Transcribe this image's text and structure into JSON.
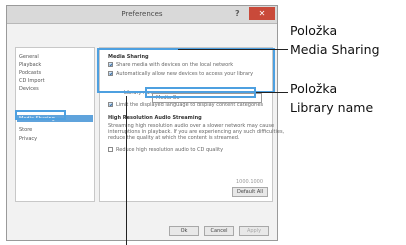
{
  "dialog": {
    "title": "Preferences",
    "help_glyph": "?",
    "close_glyph": "✕",
    "sidebar_items": [
      "General",
      "Playback",
      "Podcasts",
      "CD Import",
      "Devices",
      "Media Sharing",
      "Store",
      "Privacy"
    ],
    "selected_index": 5,
    "media_sharing": {
      "heading": "Media Sharing",
      "share_text": "Share media with devices on the local network",
      "auto_allow_text": "Automatically allow new devices to access your library",
      "library_name_label": "Library name:",
      "library_name_value": "Media Go",
      "adaptive_text": "Limit the displayed language to display content categories"
    },
    "hires": {
      "heading": "High Resolution Audio Streaming",
      "desc_lines": [
        "Streaming high resolution audio over a slower network may cause",
        "interruptions in playback. If you are experiencing any such difficulties,",
        "reduce the quality at which the content is streamed."
      ],
      "reduce_text": "Reduce high resolution audio to CD quality"
    },
    "version": "1000.1000",
    "default_all_label": "Default All",
    "ok_label": "Ok",
    "cancel_label": "Cancel",
    "apply_label": "Apply"
  },
  "annotations": {
    "media_sharing_line1": "Položka",
    "media_sharing_line2": "Media Sharing",
    "library_name_line1": "Položka",
    "library_name_line2": "Library name"
  },
  "colors": {
    "callout": "#4ea0e0",
    "selection": "#5fa3dc",
    "close_button": "#c94a3a"
  }
}
